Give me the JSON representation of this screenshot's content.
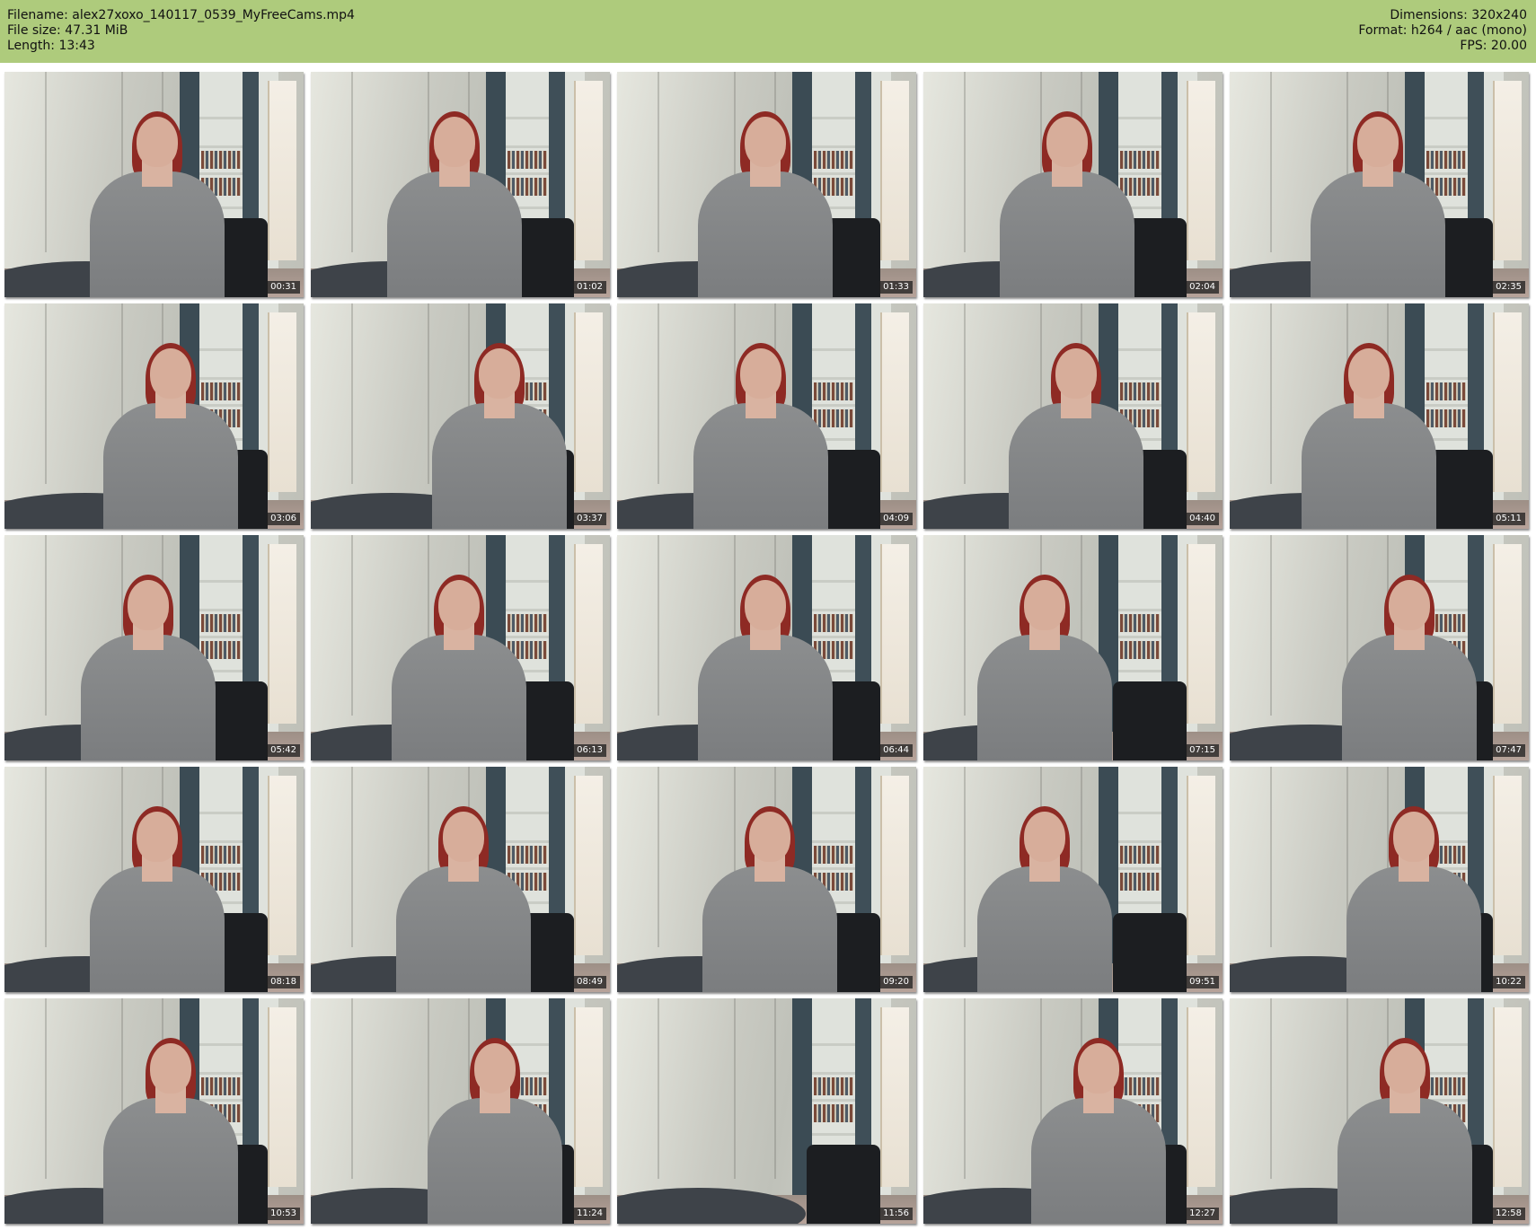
{
  "header": {
    "filename_line": "Filename: alex27xoxo_140117_0539_MyFreeCams.mp4",
    "filesize_line": "File size: 47.31 MiB",
    "length_line": "Length: 13:43",
    "dimensions_line": "Dimensions: 320x240",
    "format_line": "Format: h264 / aac (mono)",
    "fps_line": "FPS: 20.00"
  },
  "colors": {
    "header_bg": "#aecb7c",
    "timestamp_bg": "#1e1e1e"
  },
  "thumbnails": [
    {
      "time": "00:31"
    },
    {
      "time": "01:02"
    },
    {
      "time": "01:33"
    },
    {
      "time": "02:04"
    },
    {
      "time": "02:35"
    },
    {
      "time": "03:06"
    },
    {
      "time": "03:37"
    },
    {
      "time": "04:09"
    },
    {
      "time": "04:40"
    },
    {
      "time": "05:11"
    },
    {
      "time": "05:42"
    },
    {
      "time": "06:13"
    },
    {
      "time": "06:44"
    },
    {
      "time": "07:15"
    },
    {
      "time": "07:47"
    },
    {
      "time": "08:18"
    },
    {
      "time": "08:49"
    },
    {
      "time": "09:20"
    },
    {
      "time": "09:51"
    },
    {
      "time": "10:22"
    },
    {
      "time": "10:53"
    },
    {
      "time": "11:24"
    },
    {
      "time": "11:56"
    },
    {
      "time": "12:27"
    },
    {
      "time": "12:58"
    }
  ]
}
